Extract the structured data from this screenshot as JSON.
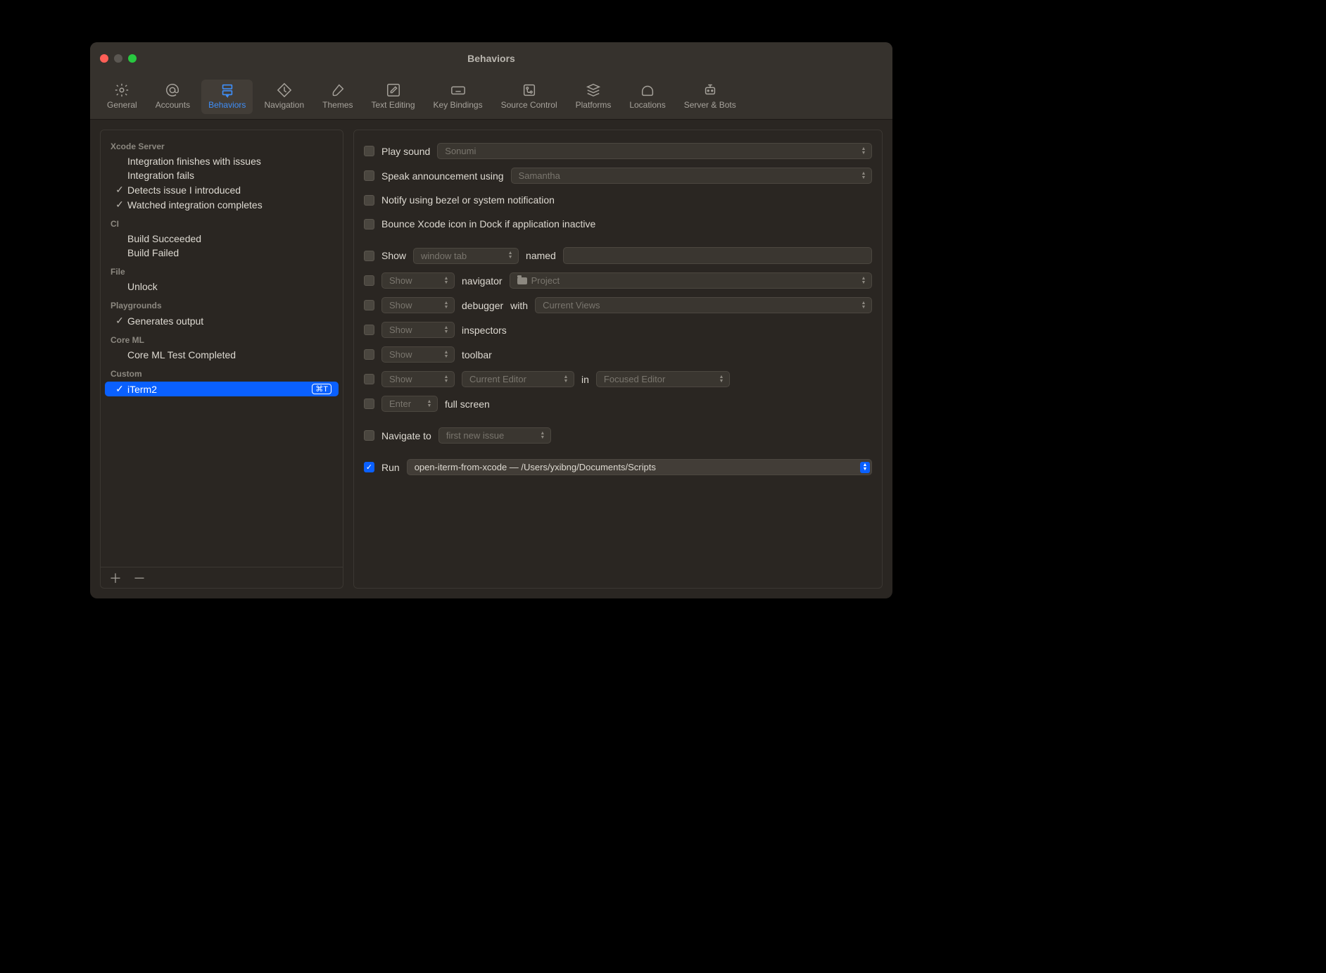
{
  "window": {
    "title": "Behaviors"
  },
  "toolbar": {
    "items": [
      {
        "label": "General"
      },
      {
        "label": "Accounts"
      },
      {
        "label": "Behaviors"
      },
      {
        "label": "Navigation"
      },
      {
        "label": "Themes"
      },
      {
        "label": "Text Editing"
      },
      {
        "label": "Key Bindings"
      },
      {
        "label": "Source Control"
      },
      {
        "label": "Platforms"
      },
      {
        "label": "Locations"
      },
      {
        "label": "Server & Bots"
      }
    ]
  },
  "sidebar": {
    "groups": [
      {
        "title": "Xcode Server",
        "items": [
          {
            "label": "Integration finishes with issues",
            "checked": false
          },
          {
            "label": "Integration fails",
            "checked": false
          },
          {
            "label": "Detects issue I introduced",
            "checked": true
          },
          {
            "label": "Watched integration completes",
            "checked": true
          }
        ]
      },
      {
        "title": "CI",
        "items": [
          {
            "label": "Build Succeeded",
            "checked": false
          },
          {
            "label": "Build Failed",
            "checked": false
          }
        ]
      },
      {
        "title": "File",
        "items": [
          {
            "label": "Unlock",
            "checked": false
          }
        ]
      },
      {
        "title": "Playgrounds",
        "items": [
          {
            "label": "Generates output",
            "checked": true
          }
        ]
      },
      {
        "title": "Core ML",
        "items": [
          {
            "label": "Core ML Test Completed",
            "checked": false
          }
        ]
      },
      {
        "title": "Custom",
        "items": [
          {
            "label": "iTerm2",
            "checked": true,
            "selected": true,
            "shortcut": "⌘T"
          }
        ]
      }
    ]
  },
  "detail": {
    "play_sound": {
      "label": "Play sound",
      "value": "Sonumi"
    },
    "speak": {
      "label": "Speak announcement using",
      "value": "Samantha"
    },
    "notify": {
      "label": "Notify using bezel or system notification"
    },
    "bounce": {
      "label": "Bounce Xcode icon in Dock if application inactive"
    },
    "show_tab": {
      "label": "Show",
      "value": "window tab",
      "named": "named"
    },
    "navigator": {
      "action": "Show",
      "label": "navigator",
      "value": "Project"
    },
    "debugger": {
      "action": "Show",
      "label": "debugger",
      "with": "with",
      "value": "Current Views"
    },
    "inspectors": {
      "action": "Show",
      "label": "inspectors"
    },
    "toolbar_show": {
      "action": "Show",
      "label": "toolbar"
    },
    "editor": {
      "action": "Show",
      "value1": "Current Editor",
      "in": "in",
      "value2": "Focused Editor"
    },
    "fullscreen": {
      "action": "Enter",
      "label": "full screen"
    },
    "navigate": {
      "label": "Navigate to",
      "value": "first new issue"
    },
    "run": {
      "label": "Run",
      "value": "open-iterm-from-xcode — /Users/yxibng/Documents/Scripts"
    }
  }
}
